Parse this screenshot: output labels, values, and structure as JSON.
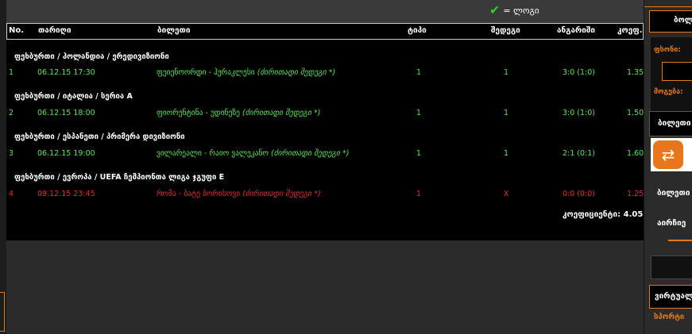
{
  "legend": {
    "won_label": "= ლოგი"
  },
  "table": {
    "headers": {
      "no": "No.",
      "date": "თარიღი",
      "event": "ბილეთი",
      "type": "ტიპი",
      "outcome": "შედეგი",
      "score": "ანგარიში",
      "coef": "კოეფ."
    },
    "groups": [
      {
        "title": "ფეხბურთი / ჰოლანდია / ერედივიზიონი",
        "row": {
          "no": "1",
          "date": "06.12.15 17:30",
          "event": "ფეიენოორდი - ჰერაკლესი",
          "note": "(ძირითადი შედეგი *)",
          "type": "1",
          "outcome": "1",
          "score": "3:0 (1:0)",
          "coef": "1.35",
          "status": "win"
        }
      },
      {
        "title": "ფეხბურთი / იტალია / სერია A",
        "row": {
          "no": "2",
          "date": "06.12.15 18:00",
          "event": "ფიორენტინა - უდინეზე",
          "note": "(ძირითადი შედეგი *)",
          "type": "1",
          "outcome": "1",
          "score": "3:0 (1:0)",
          "coef": "1.50",
          "status": "win"
        }
      },
      {
        "title": "ფეხბურთი / ესპანეთი / პრიმერა დივიზიონი",
        "row": {
          "no": "3",
          "date": "06.12.15 19:00",
          "event": "ვილარეალი - რაიო ვალეკანო",
          "note": "(ძირითადი შედეგი *)",
          "type": "1",
          "outcome": "1",
          "score": "2:1 (0:1)",
          "coef": "1.60",
          "status": "win"
        }
      },
      {
        "title": "ფეხბურთი / ევროპა / UEFA ჩემპიონთა ლიგა ჯგუფი E",
        "row": {
          "no": "4",
          "date": "09.12.15 23:45",
          "event": "რომა - ბატე ბორისოვი",
          "note": "(ძირითადი შედეგი *)",
          "type": "1",
          "outcome": "X",
          "score": "0:0 (0:0)",
          "coef": "1.25",
          "status": "lose"
        }
      }
    ],
    "total_coef": "კოეფიციენტი: 4.05"
  },
  "right_panel": {
    "tab_label": "ბოლ",
    "sum_label": "ფსონი:",
    "win_label": "მოგება:",
    "ticket_label": "ბილეთი",
    "ticket_row_label": "ბილეთი",
    "option_label": "აირჩიე",
    "virtual_label": "ვირტუალ",
    "sport_label": "სპორტი"
  },
  "colors": {
    "win": "#59e659",
    "lose": "#e23030",
    "accent": "#e07b18"
  }
}
